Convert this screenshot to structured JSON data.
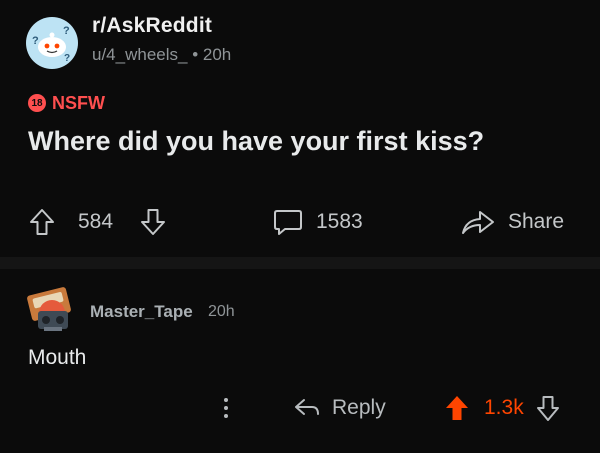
{
  "post": {
    "subreddit": "r/AskReddit",
    "author": "u/4_wheels_",
    "separator": "•",
    "time": "20h",
    "nsfw_badge": "18",
    "nsfw_label": "NSFW",
    "title": "Where did you have your first kiss?",
    "upvotes": "584",
    "comments": "1583",
    "share_label": "Share",
    "avatar_glyphs": "?"
  },
  "comment": {
    "author": "Master_Tape",
    "time": "20h",
    "body": "Mouth",
    "reply_label": "Reply",
    "score": "1.3k"
  },
  "colors": {
    "background": "#0b0b0b",
    "nsfw_red": "#ff4f4f",
    "upvote_orange": "#ff4500",
    "text_primary": "#e8eaeb",
    "text_muted": "#8f9497",
    "avatar_blue": "#bde3f4"
  },
  "icons": {
    "upvote": "upvote-arrow-icon",
    "downvote": "downvote-arrow-icon",
    "comment": "comment-bubble-icon",
    "share": "share-arrow-icon",
    "reply": "reply-arrow-icon",
    "more": "more-vertical-icon"
  }
}
